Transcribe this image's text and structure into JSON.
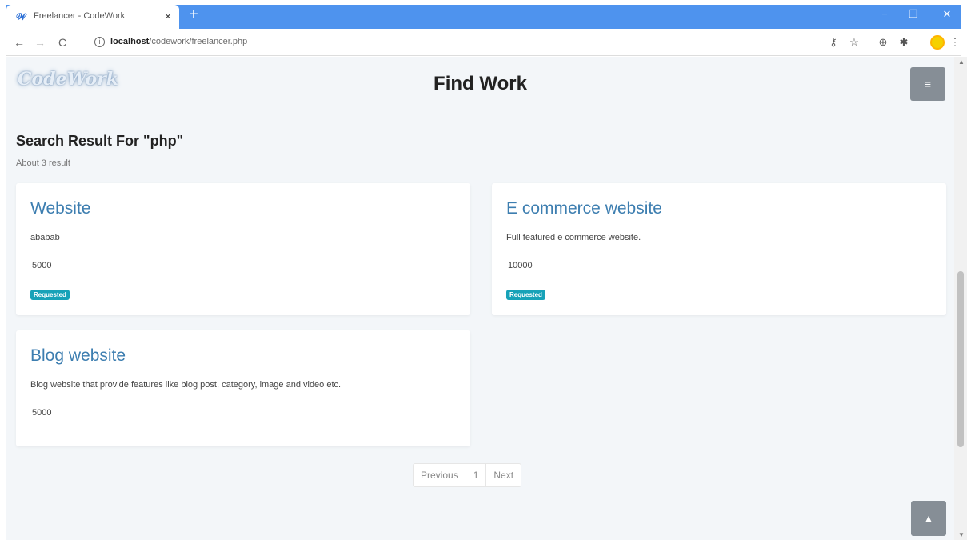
{
  "browser": {
    "tab_title": "Freelancer - CodeWork",
    "new_tab": "+",
    "url_host": "localhost",
    "url_path": "/codework/freelancer.php",
    "window_controls": {
      "minimize": "−",
      "maximize": "❐",
      "close": "✕"
    },
    "nav": {
      "back": "←",
      "forward": "→",
      "reload": "C"
    }
  },
  "header": {
    "logo": "CodeWork",
    "title": "Find Work",
    "menu_icon": "≡"
  },
  "search": {
    "heading": "Search Result For \"php\"",
    "count": "About 3 result"
  },
  "cards": [
    {
      "title": "Website",
      "description": "ababab",
      "price": "5000",
      "badge": "Requested"
    },
    {
      "title": "E commerce website",
      "description": "Full featured e commerce website.",
      "price": "10000",
      "badge": "Requested"
    },
    {
      "title": "Blog website",
      "description": "Blog website that provide features like blog post, category, image and video etc.",
      "price": "5000"
    }
  ],
  "pagination": {
    "previous": "Previous",
    "current": "1",
    "next": "Next"
  },
  "scroll_top_icon": "▲",
  "colors": {
    "accent_title": "#3d7eb0",
    "badge": "#17a2b8",
    "chrome_blue": "#4e93ee",
    "page_bg": "#f3f6f9",
    "button_gray": "#868e96"
  }
}
